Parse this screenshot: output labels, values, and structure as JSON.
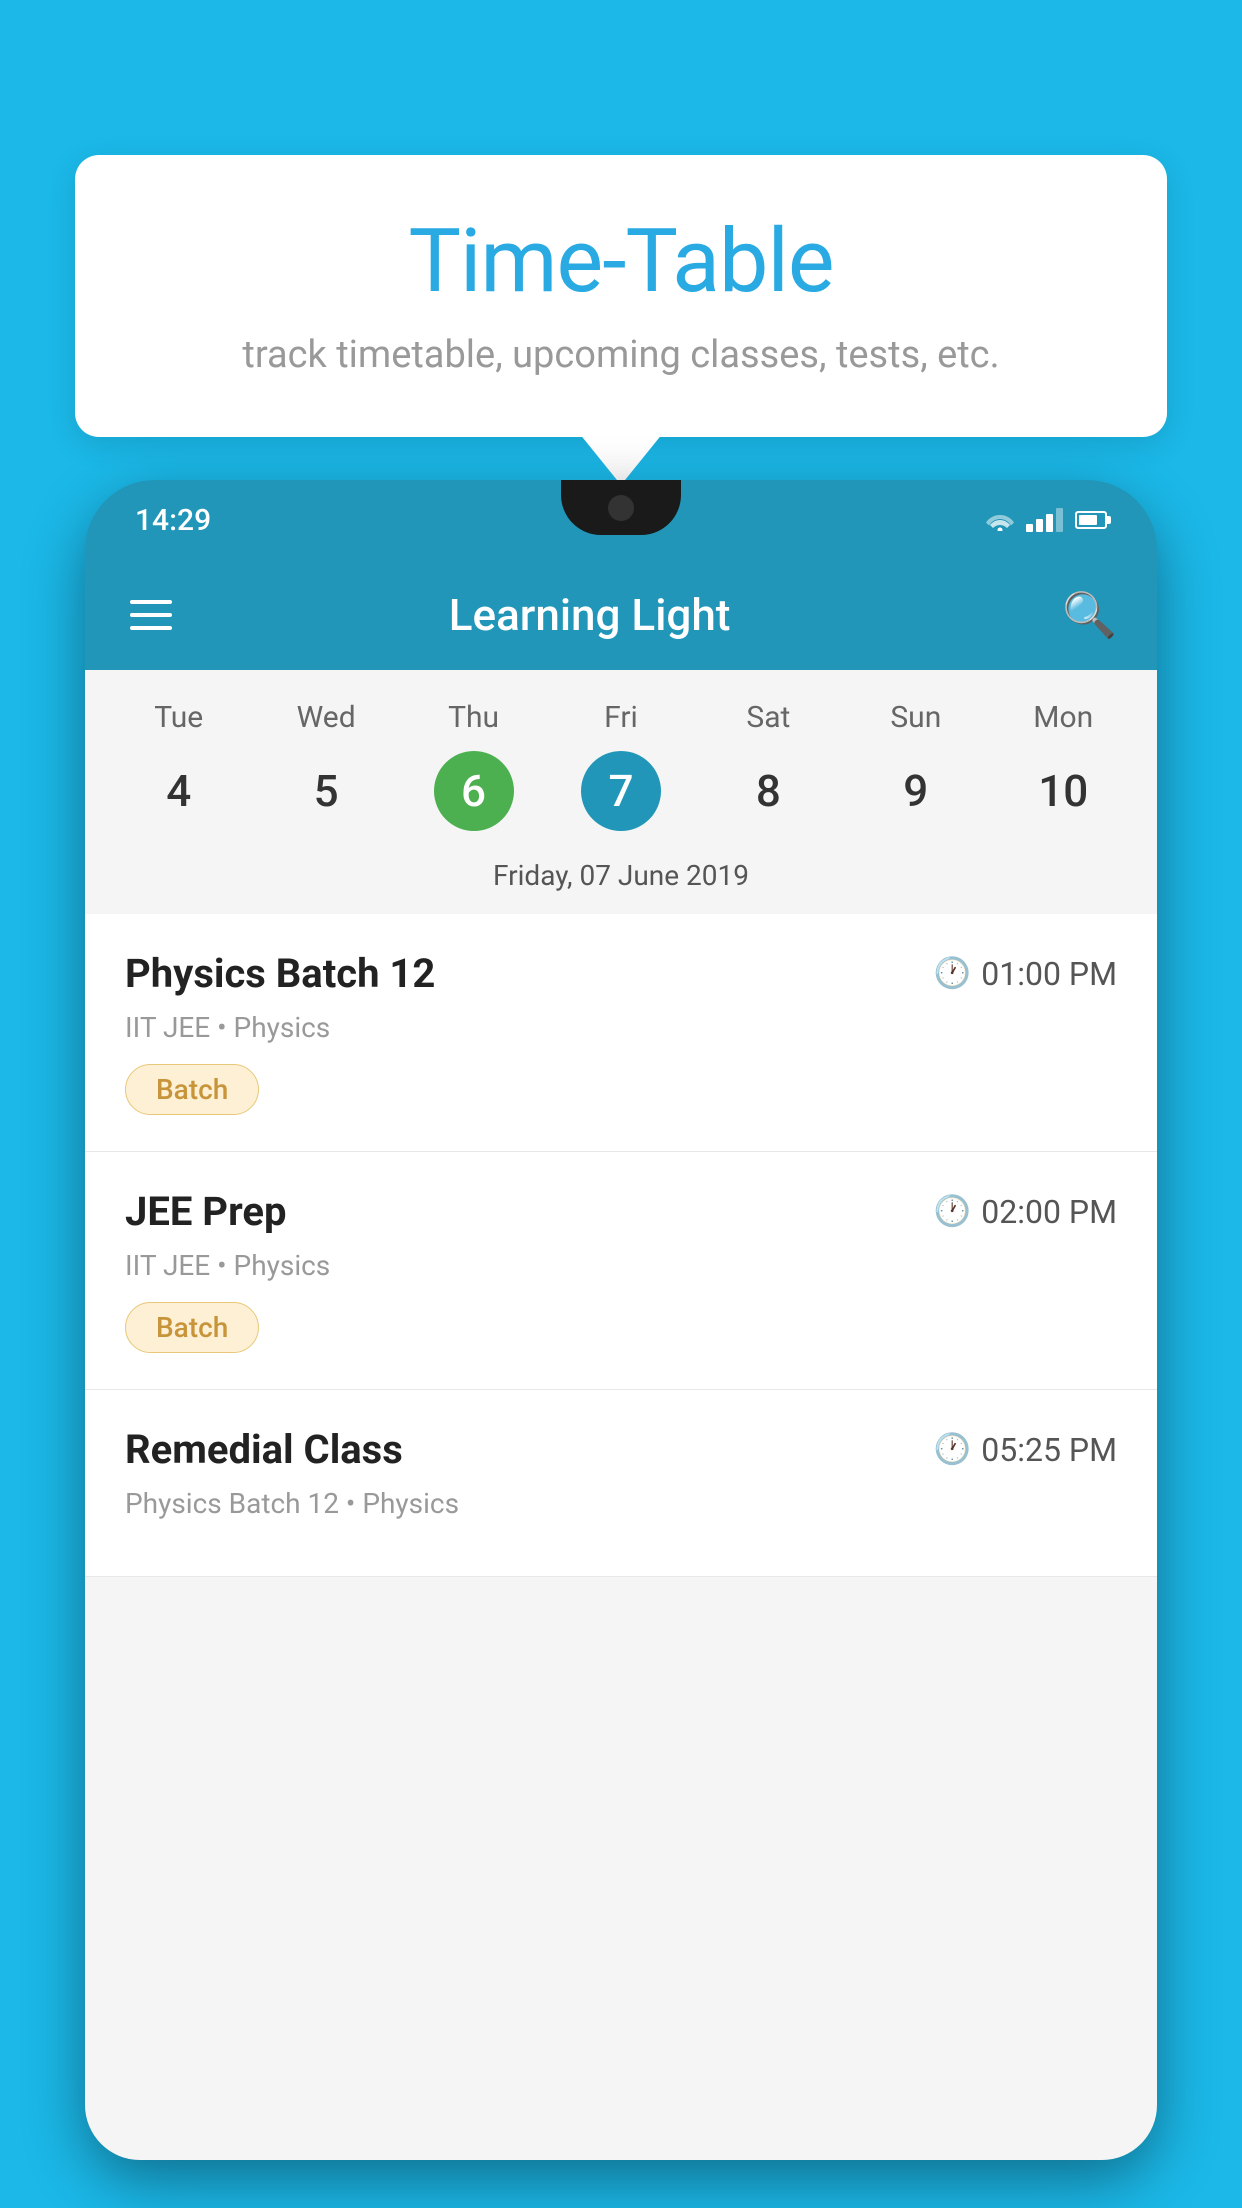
{
  "background_color": "#1bb8e8",
  "bubble": {
    "title": "Time-Table",
    "subtitle": "track timetable, upcoming classes, tests, etc."
  },
  "app": {
    "status_time": "14:29",
    "toolbar_title": "Learning Light"
  },
  "calendar": {
    "days": [
      {
        "name": "Tue",
        "num": "4",
        "state": "normal"
      },
      {
        "name": "Wed",
        "num": "5",
        "state": "normal"
      },
      {
        "name": "Thu",
        "num": "6",
        "state": "today"
      },
      {
        "name": "Fri",
        "num": "7",
        "state": "selected"
      },
      {
        "name": "Sat",
        "num": "8",
        "state": "normal"
      },
      {
        "name": "Sun",
        "num": "9",
        "state": "normal"
      },
      {
        "name": "Mon",
        "num": "10",
        "state": "normal"
      }
    ],
    "selected_label": "Friday, 07 June 2019"
  },
  "events": [
    {
      "title": "Physics Batch 12",
      "time": "01:00 PM",
      "sub": "IIT JEE • Physics",
      "badge": "Batch"
    },
    {
      "title": "JEE Prep",
      "time": "02:00 PM",
      "sub": "IIT JEE • Physics",
      "badge": "Batch"
    },
    {
      "title": "Remedial Class",
      "time": "05:25 PM",
      "sub": "Physics Batch 12 • Physics",
      "badge": null
    }
  ]
}
